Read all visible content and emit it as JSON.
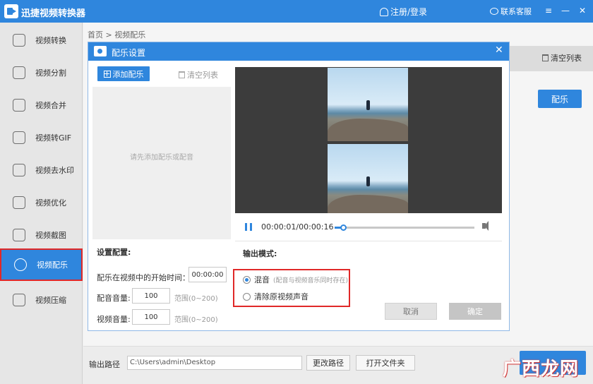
{
  "app": {
    "title": "迅捷视频转换器",
    "login": "注册/登录",
    "support": "联系客服"
  },
  "sidebar": {
    "items": [
      {
        "label": "视频转换"
      },
      {
        "label": "视频分割"
      },
      {
        "label": "视频合并"
      },
      {
        "label": "视频转GIF"
      },
      {
        "label": "视频去水印"
      },
      {
        "label": "视频优化"
      },
      {
        "label": "视频截图"
      },
      {
        "label": "视频配乐"
      },
      {
        "label": "视频压缩"
      }
    ],
    "active_index": 7
  },
  "breadcrumb": "首页 > 视频配乐",
  "background": {
    "clear_list": "清空列表",
    "music_button": "配乐"
  },
  "bottom": {
    "output_label": "输出路径",
    "output_path": "C:\\Users\\admin\\Desktop",
    "change_path": "更改路径",
    "open_folder": "打开文件夹"
  },
  "dialog": {
    "title": "配乐设置",
    "add_music": "添加配乐",
    "clear_list": "清空列表",
    "empty_hint": "请先添加配乐或配音",
    "settings_title": "设置配置:",
    "start_time_label": "配乐在视频中的开始时间：",
    "start_time_value": "00:00:00",
    "dub_volume_label": "配音音量:",
    "dub_volume_value": "100",
    "dub_volume_range": "范围(0~200)",
    "video_volume_label": "视频音量:",
    "video_volume_value": "100",
    "video_volume_range": "范围(0~200)",
    "player": {
      "time": "00:00:01/00:00:16",
      "progress": 0.06
    },
    "output_mode_title": "输出模式:",
    "mix_label": "混音",
    "mix_note": "(配音与视频音乐同时存在)",
    "remove_label": "清除原视频声音",
    "cancel": "取消",
    "ok": "确定"
  },
  "watermark": "广西龙网"
}
